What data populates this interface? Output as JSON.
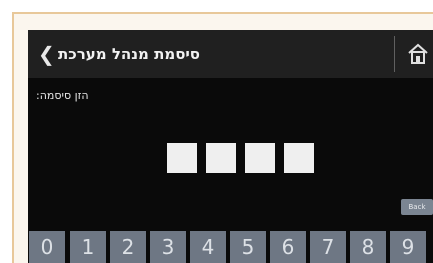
{
  "header": {
    "title": "סיסמת מנהל מערכת",
    "back_icon": "chevron-left-icon",
    "home_icon": "home-icon"
  },
  "prompt": "הזן סיסמה:",
  "pin": {
    "slots": 4
  },
  "function_button": {
    "label": "Back"
  },
  "keypad": {
    "keys": [
      "0",
      "1",
      "2",
      "3",
      "4",
      "5",
      "6",
      "7",
      "8",
      "9"
    ]
  },
  "colors": {
    "background": "#0a0a0a",
    "titlebar": "#202020",
    "key": "#6e7784",
    "pin_box": "#efefef",
    "frame_border": "#e8c89a"
  }
}
